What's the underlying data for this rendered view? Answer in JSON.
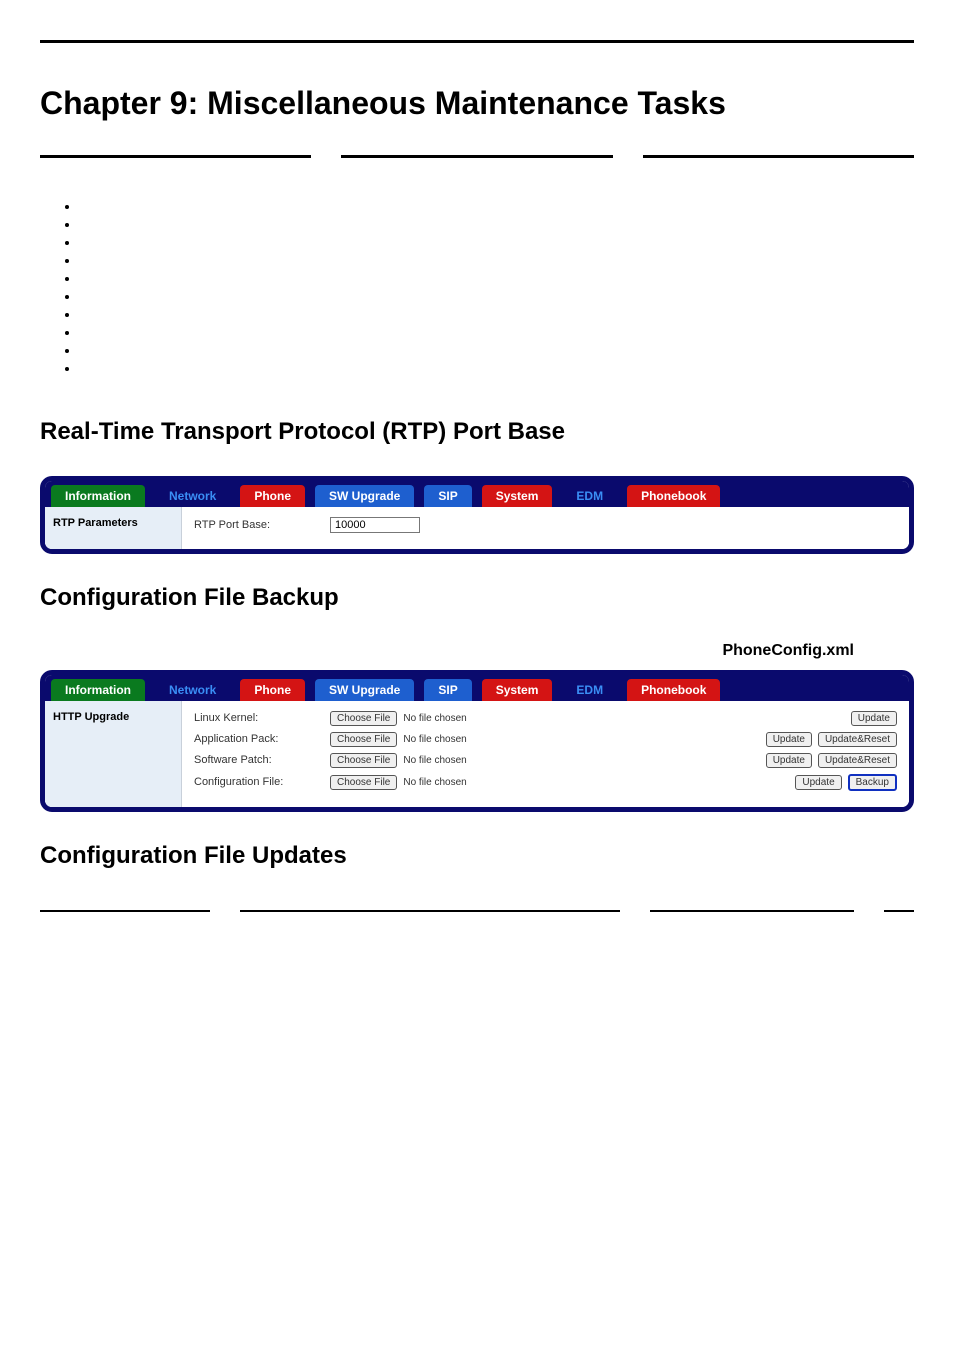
{
  "chapter_title": "Chapter 9: Miscellaneous Maintenance Tasks",
  "section_rtp": "Real-Time Transport Protocol (RTP) Port Base",
  "section_backup": "Configuration File Backup",
  "backup_filename": "PhoneConfig.xml",
  "section_updates": "Configuration File Updates",
  "tabs": {
    "information": "Information",
    "network": "Network",
    "phone": "Phone",
    "sw_upgrade": "SW Upgrade",
    "sip": "SIP",
    "system": "System",
    "edm": "EDM",
    "phonebook": "Phonebook"
  },
  "panel1": {
    "side_label": "RTP Parameters",
    "row_label": "RTP Port Base:",
    "value": "10000"
  },
  "panel2": {
    "side_label": "HTTP Upgrade",
    "choose_file": "Choose File",
    "no_file": "No file chosen",
    "update": "Update",
    "update_reset": "Update&Reset",
    "backup": "Backup",
    "rows": {
      "kernel": "Linux Kernel:",
      "app": "Application Pack:",
      "patch": "Software Patch:",
      "config": "Configuration File:"
    }
  }
}
